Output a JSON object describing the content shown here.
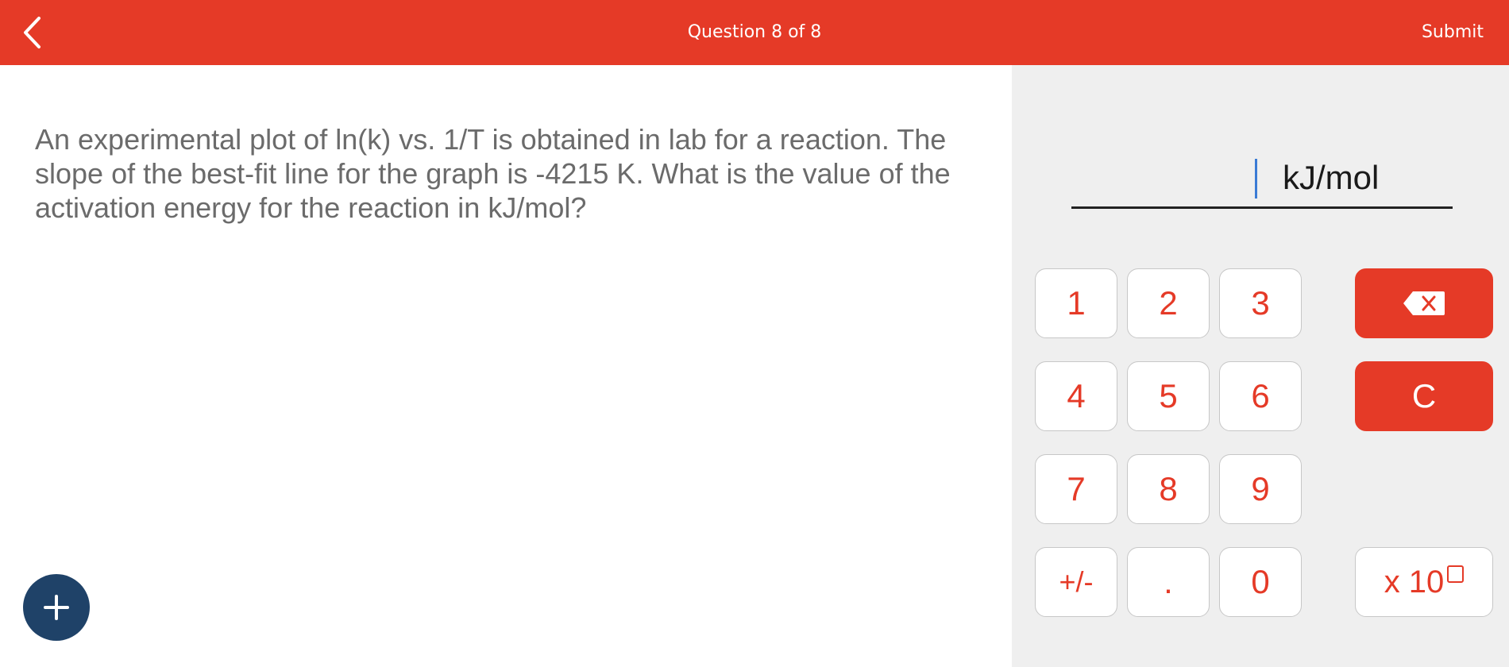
{
  "header": {
    "title": "Question 8 of 8",
    "submit_label": "Submit"
  },
  "question": {
    "text": "An experimental plot of ln(k) vs. 1/T is obtained in lab for a reaction. The slope of the best-fit line for the graph is -4215 K. What is the value of the activation energy for the reaction in kJ/mol?"
  },
  "answer": {
    "value": "",
    "unit": "kJ/mol"
  },
  "keypad": {
    "keys": [
      "1",
      "2",
      "3",
      "4",
      "5",
      "6",
      "7",
      "8",
      "9",
      "+/-",
      ".",
      "0"
    ],
    "clear_label": "C",
    "exponent_label": "x 10"
  },
  "icons": {
    "back": "chevron-left-icon",
    "backspace": "backspace-icon",
    "add": "plus-icon"
  },
  "colors": {
    "accent": "#e53a27",
    "fab": "#1f4268",
    "panel_bg": "#efefef",
    "caret": "#3a7bd5"
  }
}
